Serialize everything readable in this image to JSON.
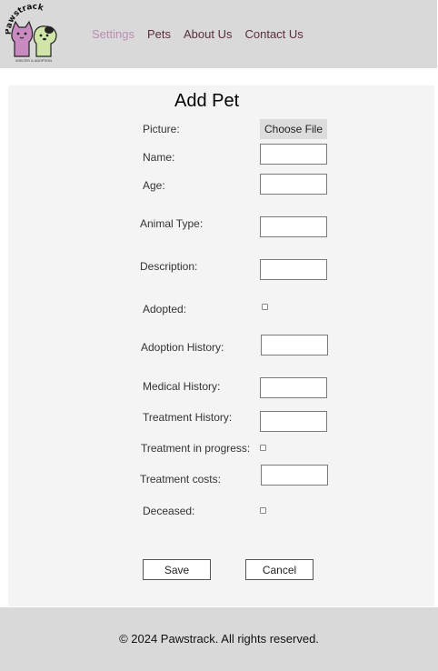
{
  "logo": {
    "text": "Pawstrack",
    "subtitle": "SHELTER & ADOPTION"
  },
  "nav": {
    "settings": "Settings",
    "pets": "Pets",
    "about": "About Us",
    "contact": "Contact Us"
  },
  "form": {
    "title": "Add Pet",
    "picture_label": "Picture:",
    "choose_file": "Choose File",
    "name_label": "Name:",
    "age_label": "Age:",
    "animal_type_label": "Animal Type:",
    "description_label": "Description:",
    "adopted_label": "Adopted:",
    "adoption_history_label": "Adoption History:",
    "medical_history_label": "Medical History:",
    "treatment_history_label": "Treatment History:",
    "treatment_in_progress_label": "Treatment in progress:",
    "treatment_costs_label": "Treatment costs:",
    "deceased_label": "Deceased:",
    "save": "Save",
    "cancel": "Cancel"
  },
  "footer": {
    "text": "© 2024 Pawstrack. All rights reserved."
  },
  "colors": {
    "header_bg": "#d9d9d9",
    "nav_active": "#b98eb0",
    "nav_link": "#5a2f3a",
    "panel_bg": "#f4f4f4"
  }
}
